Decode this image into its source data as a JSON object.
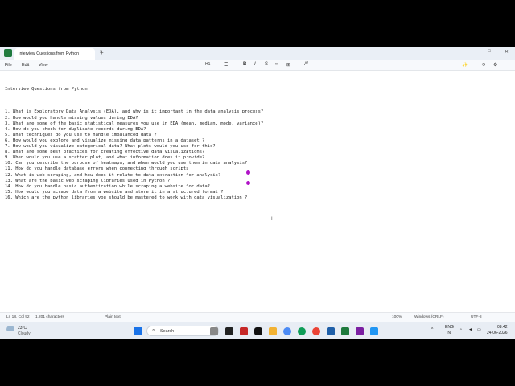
{
  "window": {
    "tab_title": "Interview Questions from Python",
    "tab_close": "×",
    "tab_add": "+",
    "minimize": "–",
    "maximize": "□",
    "close": "✕"
  },
  "menu": {
    "file": "File",
    "edit": "Edit",
    "view": "View"
  },
  "toolbar": {
    "heading": "H1",
    "list": "☰",
    "bold": "B",
    "italic": "I",
    "strike": "S",
    "link": "∞",
    "table": "⊞",
    "clear_format": "A̸",
    "effects": "✨",
    "undo": "⟲",
    "settings": "⚙"
  },
  "document": {
    "title": "Interview Questions from Python",
    "questions": [
      "1. What is Exploratory Data Analysis (EDA), and why is it important in the data analysis process?",
      "2. How would you handle missing values during EDA?",
      "3. What are some of the basic statistical measures you use in EDA (mean, median, mode, variance)?",
      "4. How do you check for duplicate records during EDA?",
      "5. What techniques do you use to handle imbalanced data ?",
      "6. How would you explore and visualize missing data patterns in a dataset ?",
      "7. How would you visualize categorical data? What plots would you use for this?",
      "8. What are some best practices for creating effective data visualizations?",
      "9. When would you use a scatter plot, and what information does it provide?",
      "10. Can you describe the purpose of heatmaps, and when would you use them in data analysis?",
      "11. How do you handle database errors when connecting through scripts",
      "12. What is web scraping, and how does it relate to data extraction for analysis?",
      "13. What are the basic web scraping libraries used in Python ?",
      "14. How do you handle basic authentication while scraping a website for data?",
      "15. How would you scrape data from a website and store it in a structured format ?",
      "16. Which are the python libraries you should be mastered to work with data visualization ?"
    ]
  },
  "status": {
    "position": "Ln 18, Col 92",
    "characters": "1,201 characters",
    "format": "Plain text",
    "zoom": "100%",
    "line_ending": "Windows (CRLF)",
    "encoding": "UTF-8"
  },
  "taskbar": {
    "weather_temp": "23°C",
    "weather_desc": "Cloudy",
    "search_label": "Search",
    "lang_line1": "ENG",
    "lang_line2": "IN",
    "time": "08:42",
    "date": "24-06-2026",
    "tray_arrow": "^"
  },
  "colors": {
    "selection_handle": "#b012c7",
    "window_start": "#1a73e8"
  }
}
